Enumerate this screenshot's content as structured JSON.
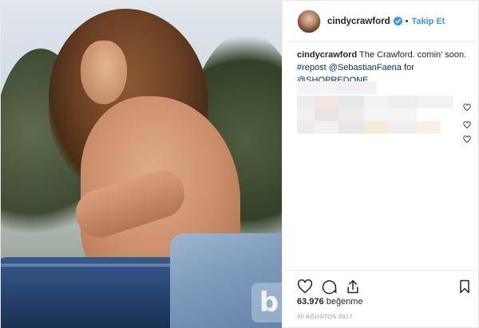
{
  "post": {
    "username": "cindycrawford",
    "dot": "•",
    "follow_label": "Takip Et",
    "verified_color": "#3897f0",
    "caption": {
      "author": "cindycrawford",
      "text": "The Crawford. comin' soon.",
      "repost_tag": "#repost",
      "mention1": "@SebastianFaena",
      "for_word": "for",
      "mention2": "@SHOPREDONE"
    },
    "likes_count": "63.976",
    "likes_label": "beğenme",
    "date": "30 AĞUSTOS 2017",
    "icons": {
      "like": "heart-icon",
      "comment": "comment-icon",
      "share": "share-icon",
      "save": "bookmark-icon",
      "verified": "verified-badge-icon",
      "comment_like": "heart-icon"
    },
    "watermark": "b"
  }
}
